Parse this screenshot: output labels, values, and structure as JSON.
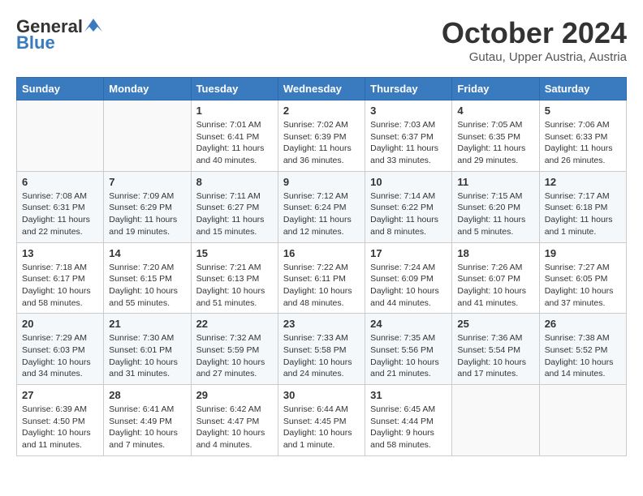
{
  "header": {
    "logo_general": "General",
    "logo_blue": "Blue",
    "month_title": "October 2024",
    "subtitle": "Gutau, Upper Austria, Austria"
  },
  "days_of_week": [
    "Sunday",
    "Monday",
    "Tuesday",
    "Wednesday",
    "Thursday",
    "Friday",
    "Saturday"
  ],
  "weeks": [
    [
      {
        "day": "",
        "info": ""
      },
      {
        "day": "",
        "info": ""
      },
      {
        "day": "1",
        "info": "Sunrise: 7:01 AM\nSunset: 6:41 PM\nDaylight: 11 hours and 40 minutes."
      },
      {
        "day": "2",
        "info": "Sunrise: 7:02 AM\nSunset: 6:39 PM\nDaylight: 11 hours and 36 minutes."
      },
      {
        "day": "3",
        "info": "Sunrise: 7:03 AM\nSunset: 6:37 PM\nDaylight: 11 hours and 33 minutes."
      },
      {
        "day": "4",
        "info": "Sunrise: 7:05 AM\nSunset: 6:35 PM\nDaylight: 11 hours and 29 minutes."
      },
      {
        "day": "5",
        "info": "Sunrise: 7:06 AM\nSunset: 6:33 PM\nDaylight: 11 hours and 26 minutes."
      }
    ],
    [
      {
        "day": "6",
        "info": "Sunrise: 7:08 AM\nSunset: 6:31 PM\nDaylight: 11 hours and 22 minutes."
      },
      {
        "day": "7",
        "info": "Sunrise: 7:09 AM\nSunset: 6:29 PM\nDaylight: 11 hours and 19 minutes."
      },
      {
        "day": "8",
        "info": "Sunrise: 7:11 AM\nSunset: 6:27 PM\nDaylight: 11 hours and 15 minutes."
      },
      {
        "day": "9",
        "info": "Sunrise: 7:12 AM\nSunset: 6:24 PM\nDaylight: 11 hours and 12 minutes."
      },
      {
        "day": "10",
        "info": "Sunrise: 7:14 AM\nSunset: 6:22 PM\nDaylight: 11 hours and 8 minutes."
      },
      {
        "day": "11",
        "info": "Sunrise: 7:15 AM\nSunset: 6:20 PM\nDaylight: 11 hours and 5 minutes."
      },
      {
        "day": "12",
        "info": "Sunrise: 7:17 AM\nSunset: 6:18 PM\nDaylight: 11 hours and 1 minute."
      }
    ],
    [
      {
        "day": "13",
        "info": "Sunrise: 7:18 AM\nSunset: 6:17 PM\nDaylight: 10 hours and 58 minutes."
      },
      {
        "day": "14",
        "info": "Sunrise: 7:20 AM\nSunset: 6:15 PM\nDaylight: 10 hours and 55 minutes."
      },
      {
        "day": "15",
        "info": "Sunrise: 7:21 AM\nSunset: 6:13 PM\nDaylight: 10 hours and 51 minutes."
      },
      {
        "day": "16",
        "info": "Sunrise: 7:22 AM\nSunset: 6:11 PM\nDaylight: 10 hours and 48 minutes."
      },
      {
        "day": "17",
        "info": "Sunrise: 7:24 AM\nSunset: 6:09 PM\nDaylight: 10 hours and 44 minutes."
      },
      {
        "day": "18",
        "info": "Sunrise: 7:26 AM\nSunset: 6:07 PM\nDaylight: 10 hours and 41 minutes."
      },
      {
        "day": "19",
        "info": "Sunrise: 7:27 AM\nSunset: 6:05 PM\nDaylight: 10 hours and 37 minutes."
      }
    ],
    [
      {
        "day": "20",
        "info": "Sunrise: 7:29 AM\nSunset: 6:03 PM\nDaylight: 10 hours and 34 minutes."
      },
      {
        "day": "21",
        "info": "Sunrise: 7:30 AM\nSunset: 6:01 PM\nDaylight: 10 hours and 31 minutes."
      },
      {
        "day": "22",
        "info": "Sunrise: 7:32 AM\nSunset: 5:59 PM\nDaylight: 10 hours and 27 minutes."
      },
      {
        "day": "23",
        "info": "Sunrise: 7:33 AM\nSunset: 5:58 PM\nDaylight: 10 hours and 24 minutes."
      },
      {
        "day": "24",
        "info": "Sunrise: 7:35 AM\nSunset: 5:56 PM\nDaylight: 10 hours and 21 minutes."
      },
      {
        "day": "25",
        "info": "Sunrise: 7:36 AM\nSunset: 5:54 PM\nDaylight: 10 hours and 17 minutes."
      },
      {
        "day": "26",
        "info": "Sunrise: 7:38 AM\nSunset: 5:52 PM\nDaylight: 10 hours and 14 minutes."
      }
    ],
    [
      {
        "day": "27",
        "info": "Sunrise: 6:39 AM\nSunset: 4:50 PM\nDaylight: 10 hours and 11 minutes."
      },
      {
        "day": "28",
        "info": "Sunrise: 6:41 AM\nSunset: 4:49 PM\nDaylight: 10 hours and 7 minutes."
      },
      {
        "day": "29",
        "info": "Sunrise: 6:42 AM\nSunset: 4:47 PM\nDaylight: 10 hours and 4 minutes."
      },
      {
        "day": "30",
        "info": "Sunrise: 6:44 AM\nSunset: 4:45 PM\nDaylight: 10 hours and 1 minute."
      },
      {
        "day": "31",
        "info": "Sunrise: 6:45 AM\nSunset: 4:44 PM\nDaylight: 9 hours and 58 minutes."
      },
      {
        "day": "",
        "info": ""
      },
      {
        "day": "",
        "info": ""
      }
    ]
  ]
}
